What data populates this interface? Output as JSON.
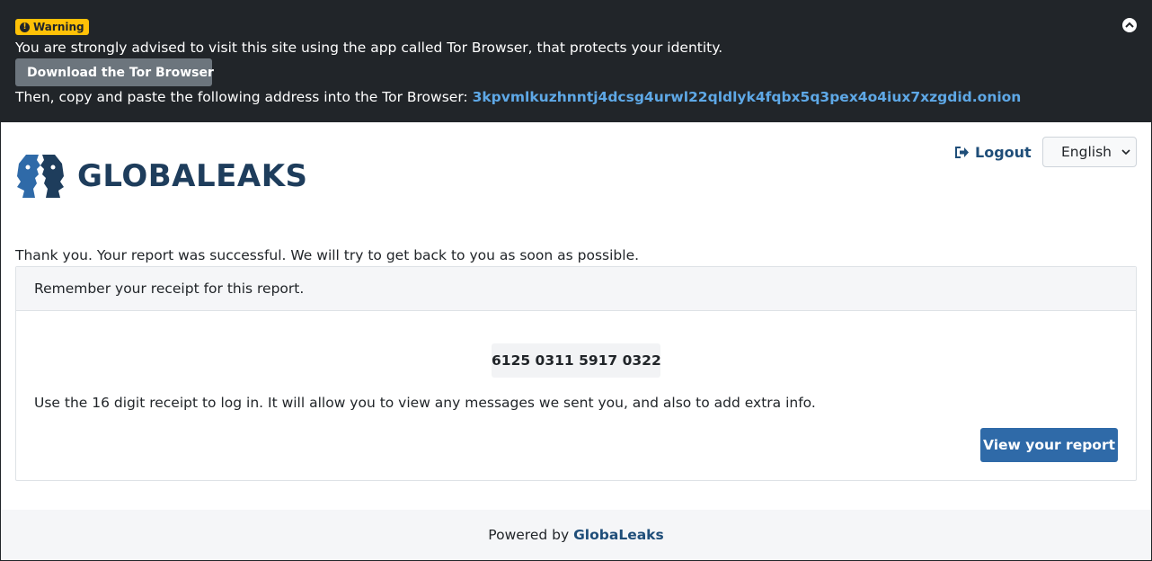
{
  "tor_banner": {
    "badge_label": "Warning",
    "advice_text": "You are strongly advised to visit this site using the app called Tor Browser, that protects your identity.",
    "download_label": "Download the Tor Browser",
    "copy_text": "Then, copy and paste the following address into the Tor Browser:",
    "onion_address": "3kpvmlkuzhnntj4dcsg4urwl22qldlyk4fqbx5q3pex4o4iux7xzgdid.onion"
  },
  "header": {
    "brand_name": "GLOBALEAKS",
    "logout_label": "Logout",
    "language": "English"
  },
  "main": {
    "thanks_text": "Thank you. Your report was successful. We will try to get back to you as soon as possible.",
    "card_header": "Remember your receipt for this report.",
    "receipt_code": "6125 0311 5917 0322",
    "receipt_info": "Use the 16 digit receipt to log in. It will allow you to view any messages we sent you, and also to add extra info.",
    "view_report_label": "View your report"
  },
  "footer": {
    "powered_by": "Powered by",
    "link_label": "GlobaLeaks"
  },
  "colors": {
    "banner_bg": "#212529",
    "warning": "#ffc107",
    "onion_link": "#5ea8e6",
    "brand": "#1e3d5c",
    "primary_button": "#2f6aa8",
    "logo_blue": "#2f6aa8"
  },
  "icons": {
    "warning_badge": "exclamation-circle-icon",
    "download": "download-icon",
    "close_banner": "chevron-up-circle-icon",
    "logout": "sign-out-icon",
    "select_arrow": "chevron-down-icon"
  }
}
